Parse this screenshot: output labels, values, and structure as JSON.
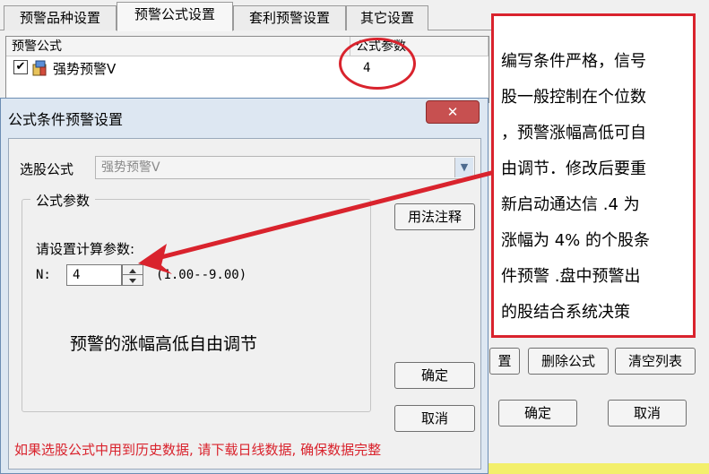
{
  "background_window": {
    "tabs": [
      "预警品种设置",
      "预警公式设置",
      "套利预警设置",
      "其它设置"
    ],
    "active_tab": 1,
    "columns": [
      "预警公式",
      "公式参数"
    ],
    "rows": [
      {
        "checked": true,
        "name": "强势预警V",
        "param": "4"
      }
    ],
    "buttons": [
      "置",
      "删除公式",
      "清空列表"
    ],
    "ok_label": "确定",
    "cancel_label": "取消"
  },
  "dialog": {
    "title": "公式条件预警设置",
    "close_glyph": "✕",
    "formula_label": "选股公式",
    "formula_value": "强势预警V",
    "group_label": "公式参数",
    "usage_button": "用法注释",
    "param_prompt": "请设置计算参数:",
    "param_name": "N:",
    "param_value": "4",
    "param_range": "(1.00--9.00)",
    "annotation": "预警的涨幅高低自由调节",
    "ok_label": "确定",
    "cancel_label": "取消",
    "warning": "如果选股公式中用到历史数据, 请下载日线数据, 确保数据完整"
  },
  "callout": {
    "lines": [
      "编写条件严格，信号",
      "股一般控制在个位数",
      "，预警涨幅高低可自",
      "由调节．修改后要重",
      "新启动通达信 .4 为",
      "涨幅为 4% 的个股条",
      "件预警 .盘中预警出",
      "的股结合系统决策"
    ]
  },
  "colors": {
    "accent_red": "#d9232d",
    "dialog_frame": "#dde7f2",
    "bottom_bar": "#f3ef6b"
  }
}
